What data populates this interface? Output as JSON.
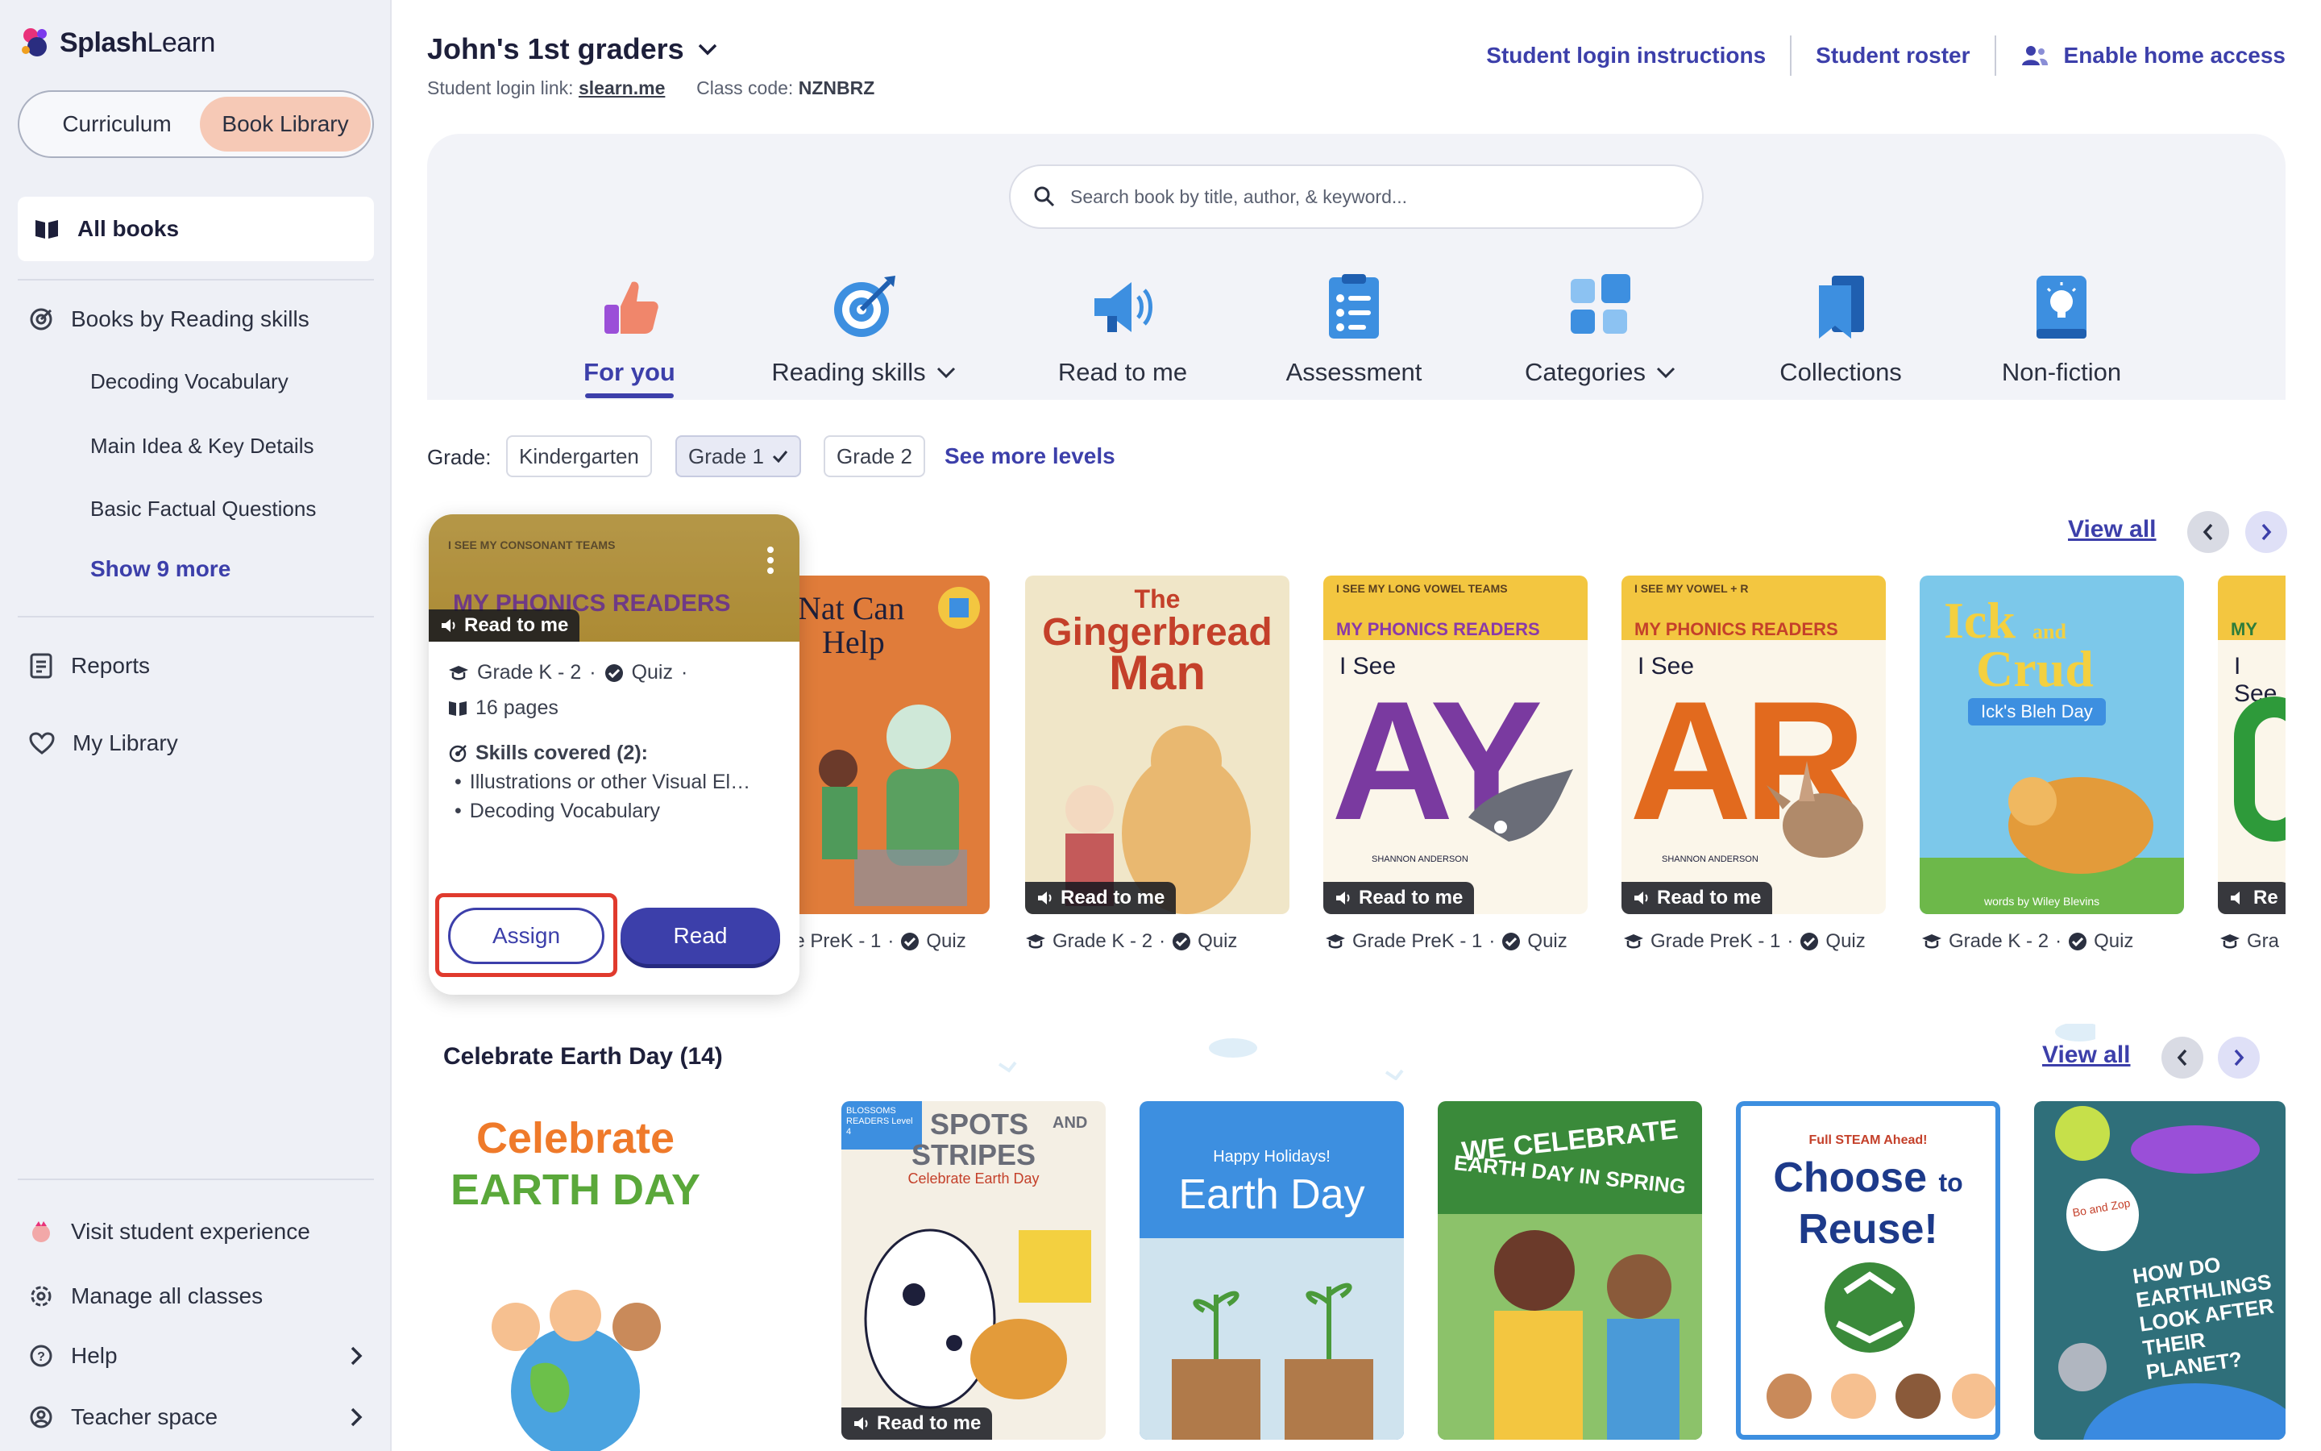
{
  "app": {
    "brand_bold": "Splash",
    "brand_light": "Learn"
  },
  "sidebar": {
    "toggle": {
      "curriculum": "Curriculum",
      "book_library": "Book Library"
    },
    "all_books": "All books",
    "reading_skills": "Books by Reading skills",
    "skills": [
      "Decoding Vocabulary",
      "Main Idea & Key Details",
      "Basic Factual Questions"
    ],
    "show_more": "Show 9 more",
    "reports": "Reports",
    "my_library": "My Library",
    "visit_student": "Visit student experience",
    "manage_classes": "Manage all classes",
    "help": "Help",
    "teacher_space": "Teacher space"
  },
  "header": {
    "class_name": "John's 1st graders",
    "login_link_label": "Student login link:",
    "login_link": "slearn.me",
    "class_code_label": "Class code:",
    "class_code": "NZNBRZ",
    "links": {
      "login_instructions": "Student login instructions",
      "roster": "Student roster",
      "home_access": "Enable home access"
    }
  },
  "search": {
    "placeholder": "Search book by title, author, & keyword..."
  },
  "categories": [
    {
      "label": "For you",
      "icon": "thumbs-up-icon",
      "active": true
    },
    {
      "label": "Reading skills",
      "icon": "target-icon",
      "dropdown": true
    },
    {
      "label": "Read to me",
      "icon": "megaphone-icon"
    },
    {
      "label": "Assessment",
      "icon": "checklist-icon"
    },
    {
      "label": "Categories",
      "icon": "grid-icon",
      "dropdown": true
    },
    {
      "label": "Collections",
      "icon": "bookmark-icon"
    },
    {
      "label": "Non-fiction",
      "icon": "lightbulb-book-icon"
    }
  ],
  "grade_filter": {
    "label": "Grade:",
    "options": [
      "Kindergarten",
      "Grade 1",
      "Grade 2"
    ],
    "selected": "Grade 1",
    "see_more": "See more levels"
  },
  "shelf1": {
    "view_all": "View all",
    "hover_card": {
      "banner_top": "I SEE MY CONSONANT TEAMS",
      "banner_title": "MY PHONICS READERS",
      "read_to_me": "Read to me",
      "grade": "Grade K - 2",
      "quiz": "Quiz",
      "pages": "16 pages",
      "skills_title": "Skills covered (2):",
      "skills": [
        "Illustrations or other Visual El…",
        "Decoding Vocabulary"
      ],
      "assign": "Assign",
      "read": "Read"
    },
    "books": [
      {
        "title_1": "Nat Can",
        "title_2": "Help",
        "grade": "le PreK - 1",
        "quiz": "Quiz"
      },
      {
        "title_1": "The",
        "title_2": "Gingerbread",
        "title_3": "Man",
        "grade": "Grade K - 2",
        "quiz": "Quiz",
        "read_to_me": "Read to me"
      },
      {
        "banner_top": "I SEE MY LONG VOWEL TEAMS",
        "banner_title": "MY PHONICS READERS",
        "i_see": "I See",
        "letters": "AY",
        "author": "SHANNON ANDERSON",
        "grade": "Grade PreK - 1",
        "quiz": "Quiz",
        "read_to_me": "Read to me"
      },
      {
        "banner_top": "I SEE MY VOWEL + R",
        "banner_title": "MY PHONICS READERS",
        "i_see": "I See",
        "letters": "AR",
        "author": "SHANNON ANDERSON",
        "grade": "Grade PreK - 1",
        "quiz": "Quiz",
        "read_to_me": "Read to me"
      },
      {
        "title_1": "Ick",
        "title_and": "and",
        "title_2": "Crud",
        "subtitle": "Ick's Bleh Day",
        "author": "words by Wiley Blevins",
        "grade": "Grade K - 2",
        "quiz": "Quiz"
      },
      {
        "banner_title": "MY",
        "i_see": "I See",
        "grade": "Gra",
        "read_to_me": "Re"
      }
    ]
  },
  "shelf2": {
    "title": "Celebrate Earth Day (14)",
    "view_all": "View all",
    "books": [
      {
        "title_1": "Celebrate",
        "title_2": "EARTH DAY"
      },
      {
        "series": "BLOSSOMS READERS Level 4",
        "title_1": "SPOTS",
        "title_and": "AND",
        "title_2": "STRIPES",
        "subtitle": "Celebrate Earth Day",
        "read_to_me": "Read to me"
      },
      {
        "title_1": "Happy Holidays!",
        "title_2": "Earth Day"
      },
      {
        "title_1": "WE CELEBRATE",
        "title_2": "EARTH DAY IN SPRING"
      },
      {
        "series": "Full STEAM Ahead!",
        "title_1": "Choose",
        "title_to": "to",
        "title_2": "Reuse!"
      },
      {
        "title_1": "Bo and Zop",
        "title_2": "HOW DO EARTHLINGS LOOK AFTER THEIR PLANET?"
      }
    ]
  },
  "colors": {
    "brand": "#3c3faa",
    "highlight": "#e03a2d",
    "sidebar_bg": "#eef0f6",
    "tab_selected": "#f6c9b6"
  }
}
